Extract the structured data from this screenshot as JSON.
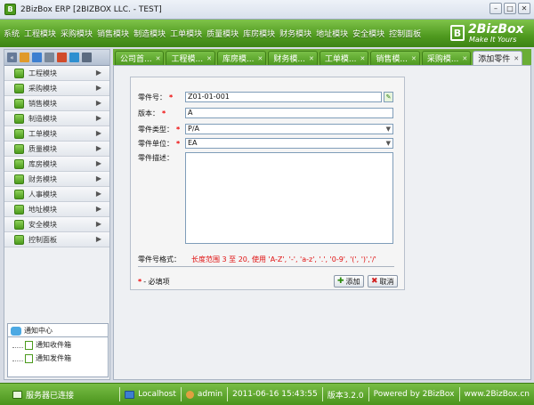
{
  "window": {
    "title": "2BizBox ERP [2BIZBOX LLC. - TEST]",
    "app_icon_letter": "B",
    "minimize": "–",
    "maximize": "□",
    "close": "✕"
  },
  "menu": {
    "items": [
      "系统",
      "工程模块",
      "采购模块",
      "销售模块",
      "制造模块",
      "工单模块",
      "质量模块",
      "库房模块",
      "财务模块",
      "地址模块",
      "安全模块",
      "控制面板"
    ]
  },
  "logo": {
    "letter": "B",
    "name": "2BizBox",
    "tagline": "Make It Yours"
  },
  "sidebar": {
    "items": [
      "工程模块",
      "采购模块",
      "销售模块",
      "制造模块",
      "工单模块",
      "质量模块",
      "库房模块",
      "财务模块",
      "人事模块",
      "地址模块",
      "安全模块",
      "控制面板"
    ],
    "notify_title": "通知中心",
    "notify_items": [
      "通知收件箱",
      "通知发件箱"
    ]
  },
  "tabs": [
    {
      "label": "公司首..."
    },
    {
      "label": "工程模..."
    },
    {
      "label": "库房模..."
    },
    {
      "label": "财务模..."
    },
    {
      "label": "工单模..."
    },
    {
      "label": "销售模..."
    },
    {
      "label": "采购模..."
    },
    {
      "label": "添加零件"
    }
  ],
  "tab_close": "✕",
  "form": {
    "part_no_label": "零件号：",
    "part_no_value": "Z01-01-001",
    "version_label": "版本：",
    "version_value": "A",
    "type_label": "零件类型：",
    "type_value": "P/A",
    "unit_label": "零件单位：",
    "unit_value": "EA",
    "desc_label": "零件描述：",
    "required_mark": "*",
    "format_label": "零件号格式：",
    "format_text": "长度范围 3 至 20, 使用  'A-Z', '-', 'a-z', '.', '0-9', '(', ')','/'",
    "required_note": "- 必填项",
    "add_label": "添加",
    "cancel_label": "取消"
  },
  "status": {
    "connection": "服务器已连接",
    "host": "Localhost",
    "user": "admin",
    "datetime": "2011-06-16 15:43:55",
    "version": "版本3.2.0",
    "powered": "Powered by 2BizBox",
    "site": "www.2BizBox.cn"
  },
  "colors": {
    "menu_green": "#4f9a1f",
    "required_red": "#e00000",
    "format_red": "#e01010"
  }
}
